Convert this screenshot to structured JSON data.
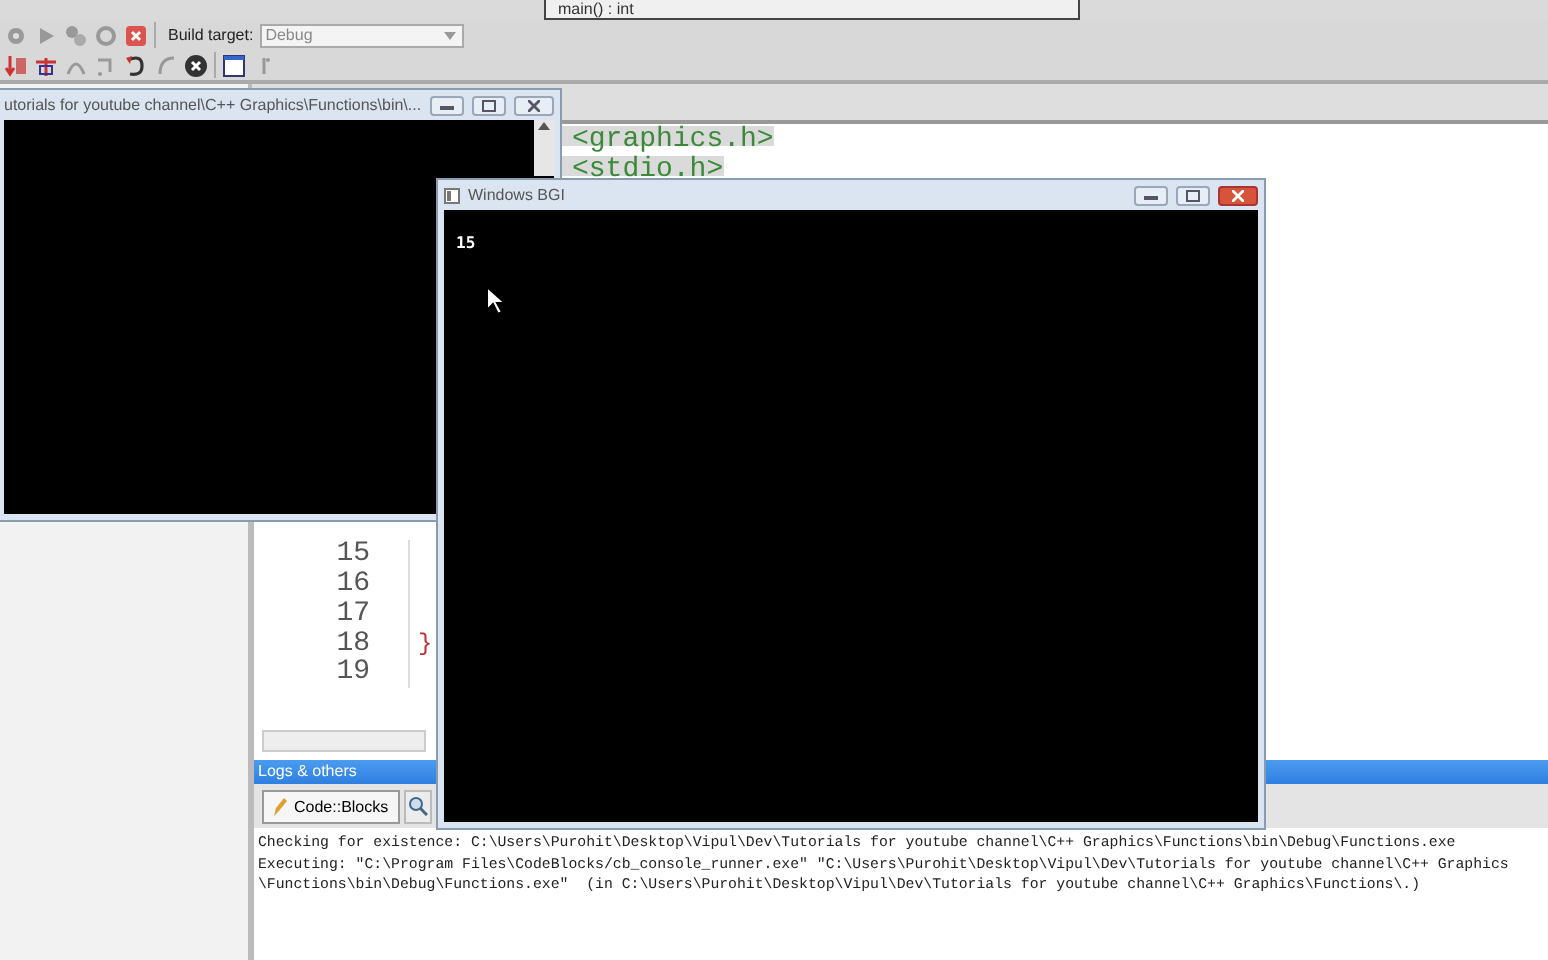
{
  "scope_box": {
    "value": "main() : int"
  },
  "toolbar": {
    "build_target_label": "Build target:",
    "build_target": "Debug"
  },
  "editor": {
    "top_lines": [
      {
        "code": "<graphics.h>"
      },
      {
        "code": "<stdio.h>"
      }
    ],
    "bottom_lines": [
      {
        "number": "15"
      },
      {
        "number": "16"
      },
      {
        "number": "17"
      },
      {
        "number": "18",
        "code": "}"
      },
      {
        "number": "19"
      }
    ]
  },
  "logs_panel": {
    "title": "Logs & others",
    "tabs": [
      {
        "label": "Code::Blocks",
        "selected": true
      }
    ],
    "log_lines": [
      "Checking for existence: C:\\Users\\Purohit\\Desktop\\Vipul\\Dev\\Tutorials for youtube channel\\C++ Graphics\\Functions\\bin\\Debug\\Functions.exe",
      "Executing: \"C:\\Program Files\\CodeBlocks/cb_console_runner.exe\" \"C:\\Users\\Purohit\\Desktop\\Vipul\\Dev\\Tutorials for youtube channel\\C++ Graphics",
      "\\Functions\\bin\\Debug\\Functions.exe\"  (in C:\\Users\\Purohit\\Desktop\\Vipul\\Dev\\Tutorials for youtube channel\\C++ Graphics\\Functions\\.)"
    ]
  },
  "console_window": {
    "title": "utorials for youtube channel\\C++ Graphics\\Functions\\bin\\..."
  },
  "bgi_window": {
    "title": "Windows BGI",
    "output": "15"
  }
}
